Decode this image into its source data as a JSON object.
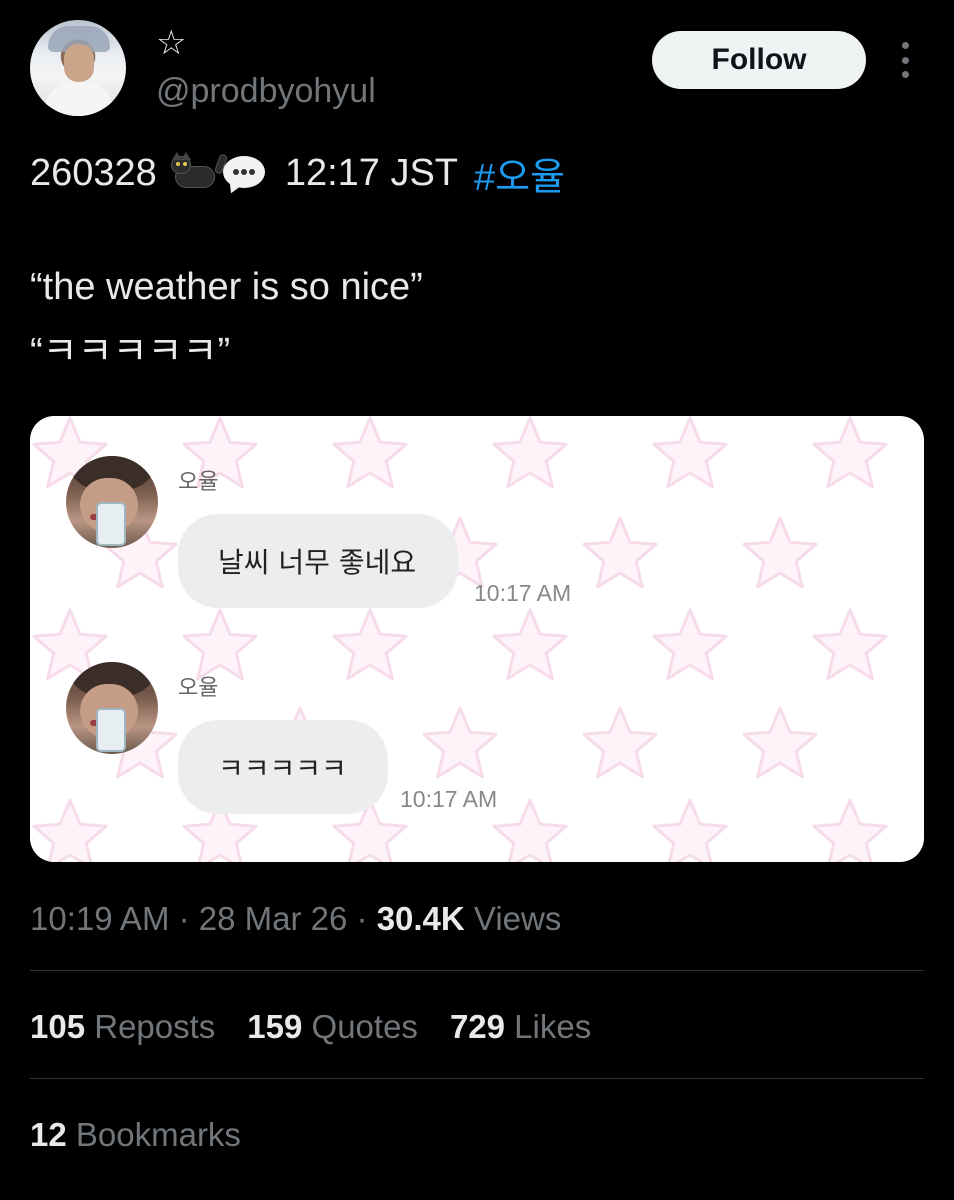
{
  "header": {
    "display_name": "☆",
    "handle": "@prodbyohyul",
    "follow_label": "Follow"
  },
  "post": {
    "date_code": "260328",
    "emoji_icons": [
      "black-cat-icon",
      "speech-bubble-icon"
    ],
    "time_jst": "12:17 JST",
    "hashtag": "#오율",
    "quote_en": "“the weather is so nice”",
    "quote_kr": "“ㅋㅋㅋㅋㅋ”"
  },
  "media": {
    "background_color": "#ffffff",
    "star_color": "#f6dcea",
    "messages": [
      {
        "sender": "오율",
        "text": "날씨 너무 좋네요",
        "time": "10:17 AM"
      },
      {
        "sender": "오율",
        "text": "ㅋㅋㅋㅋㅋ",
        "time": "10:17 AM"
      }
    ]
  },
  "meta": {
    "time": "10:19 AM",
    "sep": " · ",
    "date": "28 Mar 26",
    "views_count": "30.4K",
    "views_label": " Views"
  },
  "stats": {
    "reposts_count": "105",
    "reposts_label": " Reposts",
    "quotes_count": "159",
    "quotes_label": " Quotes",
    "likes_count": "729",
    "likes_label": " Likes",
    "bookmarks_count": "12",
    "bookmarks_label": " Bookmarks"
  },
  "colors": {
    "background": "#000000",
    "text": "#e7e9ea",
    "muted": "#71767b",
    "link": "#1d9bf0",
    "divider": "#2f3336"
  }
}
